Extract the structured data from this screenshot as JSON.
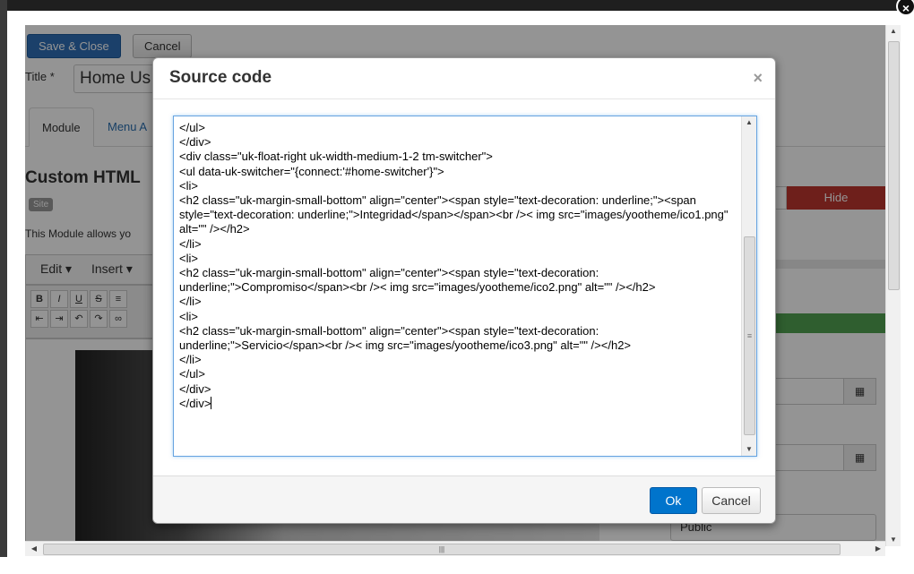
{
  "background": {
    "toolbar": {
      "save_close": "Save & Close",
      "cancel": "Cancel"
    },
    "title_label": "Title *",
    "title_value": "Home Us",
    "tabs": [
      {
        "label": "Module"
      },
      {
        "label": "Menu A"
      }
    ],
    "module_heading": "Custom HTML",
    "site_badge": "Site",
    "module_desc": "This Module allows yo",
    "editor_menu": {
      "edit": "Edit ▾",
      "insert": "Insert ▾"
    },
    "toggle_hide": "Hide",
    "access_select": "Public"
  },
  "modal": {
    "title": "Source code",
    "close_glyph": "×",
    "code": "</ul>\n</div>\n<div class=\"uk-float-right uk-width-medium-1-2 tm-switcher\">\n<ul data-uk-switcher=\"{connect:'#home-switcher'}\">\n<li>\n<h2 class=\"uk-margin-small-bottom\" align=\"center\"><span style=\"text-decoration: underline;\"><span style=\"text-decoration: underline;\">Integridad</span></span><br />< img src=\"images/yootheme/ico1.png\" alt=\"\" /></h2>\n</li>\n<li>\n<h2 class=\"uk-margin-small-bottom\" align=\"center\"><span style=\"text-decoration: underline;\">Compromiso</span><br />< img src=\"images/yootheme/ico2.png\" alt=\"\" /></h2>\n</li>\n<li>\n<h2 class=\"uk-margin-small-bottom\" align=\"center\"><span style=\"text-decoration: underline;\">Servicio</span><br />< img src=\"images/yootheme/ico3.png\" alt=\"\" /></h2>\n</li>\n</ul>\n</div>\n</div>",
    "ok_label": "Ok",
    "cancel_label": "Cancel"
  },
  "colors": {
    "primary_button": "#0074cc",
    "save_button": "#2f6fb7",
    "hide_toggle": "#bd362f",
    "status_bar": "#51a351",
    "textarea_focus": "#66a3e0"
  },
  "icons": {
    "frame_close": "close-icon",
    "calendar": "calendar-icon",
    "scroll_arrows": [
      "arrow-up-icon",
      "arrow-down-icon",
      "arrow-left-icon",
      "arrow-right-icon"
    ]
  }
}
